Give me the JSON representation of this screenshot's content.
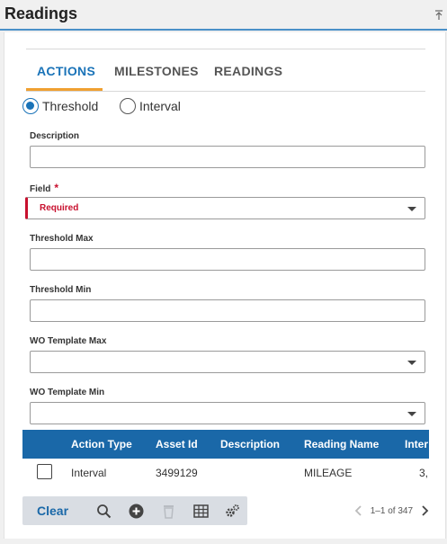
{
  "header": {
    "title": "Readings",
    "pin_icon": "pin-to-top-icon"
  },
  "tabs": [
    {
      "label": "ACTIONS",
      "active": true
    },
    {
      "label": "MILESTONES",
      "active": false
    },
    {
      "label": "READINGS",
      "active": false
    }
  ],
  "mode": {
    "options": [
      "Threshold",
      "Interval"
    ],
    "selected": "Threshold"
  },
  "form": {
    "description": {
      "label": "Description",
      "value": ""
    },
    "field": {
      "label": "Field",
      "required_marker": "*",
      "value": "Required"
    },
    "threshold_max": {
      "label": "Threshold Max",
      "value": ""
    },
    "threshold_min": {
      "label": "Threshold Min",
      "value": ""
    },
    "wo_template_max": {
      "label": "WO Template Max",
      "value": ""
    },
    "wo_template_min": {
      "label": "WO Template Min",
      "value": ""
    }
  },
  "table": {
    "columns": [
      "Action Type",
      "Asset Id",
      "Description",
      "Reading Name",
      "Inter"
    ],
    "rows": [
      {
        "action_type": "Interval",
        "asset_id": "3499129",
        "description": "",
        "reading_name": "MILEAGE",
        "interval": "3,"
      }
    ]
  },
  "toolbar": {
    "clear_label": "Clear",
    "icons": [
      "search-icon",
      "add-icon",
      "delete-icon",
      "grid-icon",
      "settings-icon"
    ]
  },
  "pager": {
    "text": "1–1 of 347"
  },
  "colors": {
    "accent": "#1a73b8",
    "tab_indicator": "#f0a030",
    "table_header": "#1a68a8",
    "error": "#c8102e"
  }
}
